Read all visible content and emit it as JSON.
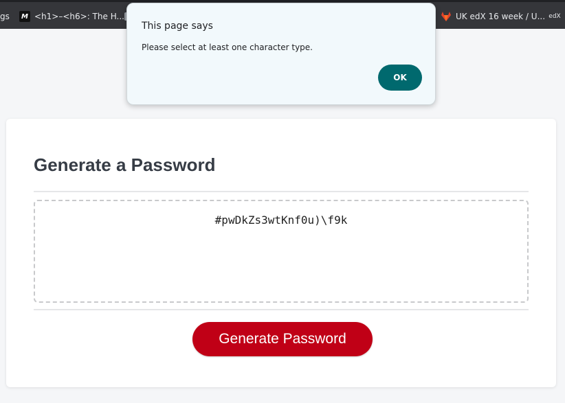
{
  "bookmarks": [
    {
      "label": "gs",
      "icon": "none"
    },
    {
      "label": "<h1>–<h6>: The H...",
      "icon": "mdn-icon"
    },
    {
      "label": "",
      "icon": "folder-icon"
    },
    {
      "label": "UK edX 16 week / U...",
      "icon": "gitlab-icon"
    },
    {
      "label": "",
      "icon": "edx-icon"
    }
  ],
  "edx_icon_text": "edX",
  "mdn_icon_text": "M",
  "card": {
    "title": "Generate a Password",
    "password": "#pwDkZs3wtKnf0u)\\f9k",
    "button_label": "Generate Password"
  },
  "dialog": {
    "title": "This page says",
    "message": "Please select at least one character type.",
    "ok_label": "OK"
  },
  "colors": {
    "accent_button": "#c00016",
    "dialog_ok": "#00696e",
    "bookmarks_bar": "#35363a"
  }
}
